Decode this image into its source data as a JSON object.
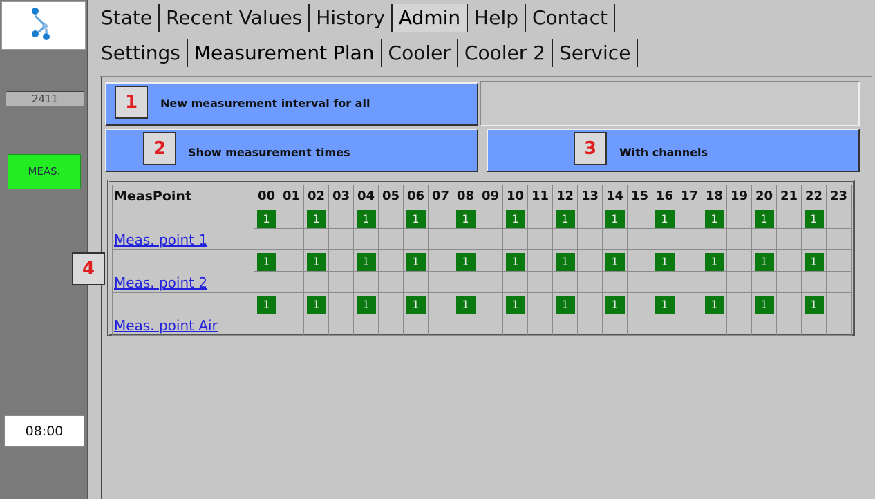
{
  "sidebar": {
    "counter": "2411",
    "mode": "MEAS.",
    "time": "08:00"
  },
  "main_tabs": [
    "State",
    "Recent Values",
    "History",
    "Admin",
    "Help",
    "Contact"
  ],
  "main_tabs_active": "Admin",
  "sub_tabs": [
    "Settings",
    "Measurement Plan",
    "Cooler",
    "Cooler 2",
    "Service"
  ],
  "sub_tabs_active": "Measurement Plan",
  "buttons": {
    "interval": "New measurement interval for all",
    "times": "Show measurement times",
    "channels": "With channels"
  },
  "callouts": [
    "1",
    "2",
    "3",
    "4"
  ],
  "table": {
    "header_label": "MeasPoint",
    "hours": [
      "00",
      "01",
      "02",
      "03",
      "04",
      "05",
      "06",
      "07",
      "08",
      "09",
      "10",
      "11",
      "12",
      "13",
      "14",
      "15",
      "16",
      "17",
      "18",
      "19",
      "20",
      "21",
      "22",
      "23"
    ],
    "rows": [
      {
        "name": "Meas. point 1",
        "channels": [
          "1",
          "",
          "1",
          "",
          "1",
          "",
          "1",
          "",
          "1",
          "",
          "1",
          "",
          "1",
          "",
          "1",
          "",
          "1",
          "",
          "1",
          "",
          "1",
          "",
          "1",
          ""
        ]
      },
      {
        "name": "Meas. point 2",
        "channels": [
          "1",
          "",
          "1",
          "",
          "1",
          "",
          "1",
          "",
          "1",
          "",
          "1",
          "",
          "1",
          "",
          "1",
          "",
          "1",
          "",
          "1",
          "",
          "1",
          "",
          "1",
          ""
        ]
      },
      {
        "name": "Meas. point Air",
        "channels": [
          "1",
          "",
          "1",
          "",
          "1",
          "",
          "1",
          "",
          "1",
          "",
          "1",
          "",
          "1",
          "",
          "1",
          "",
          "1",
          "",
          "1",
          "",
          "1",
          "",
          "1",
          ""
        ]
      }
    ]
  },
  "colors": {
    "button": "#6d9bff",
    "channel_active": "#0a7a10",
    "mode_badge": "#23ec23",
    "callout_text": "#e02020",
    "link": "#2222dd"
  }
}
